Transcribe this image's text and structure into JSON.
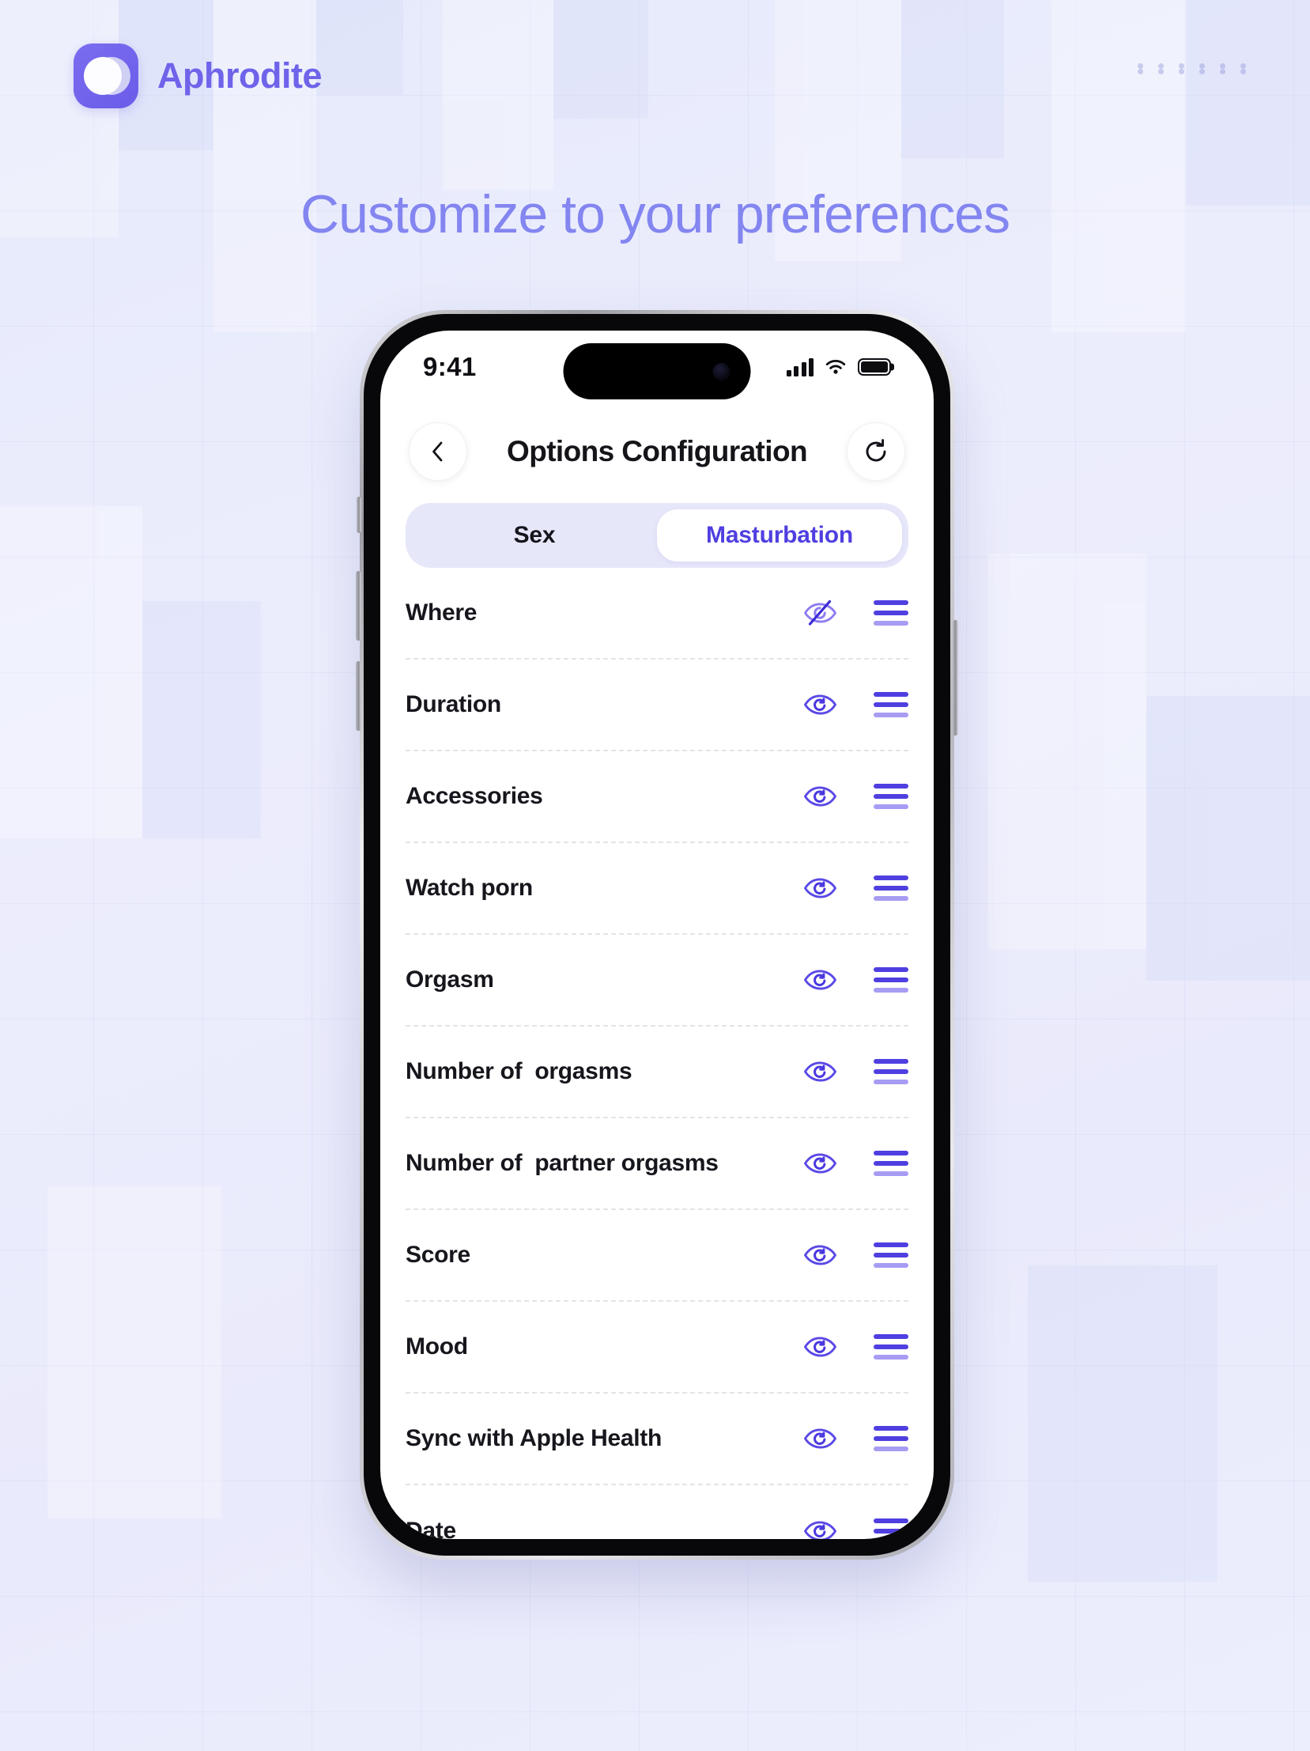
{
  "brand": {
    "name": "Aphrodite",
    "logo_icon": "moon-logo-icon",
    "accent_color": "#6f63ea"
  },
  "hero": {
    "heading": "Customize to your preferences",
    "color": "#8385f0"
  },
  "decoration": {
    "dot_grid_icon": "dot-grid-icon",
    "dot_count": 12
  },
  "phone": {
    "status_bar": {
      "time": "9:41",
      "cellular_icon": "signal-bars-icon",
      "wifi_icon": "wifi-icon",
      "battery_icon": "battery-full-icon"
    },
    "nav": {
      "back_icon": "chevron-left-icon",
      "title": "Options Configuration",
      "refresh_icon": "refresh-icon"
    },
    "segmented_control": {
      "options": [
        {
          "label": "Sex",
          "active": false
        },
        {
          "label": "Masturbation",
          "active": true
        }
      ],
      "active_index": 1,
      "active_text_color": "#4f3fe0",
      "track_color": "#e7e7fa"
    },
    "list": {
      "visibility_on_icon": "eye-icon",
      "visibility_off_icon": "eye-off-icon",
      "drag_handle_icon": "drag-handle-icon",
      "rows": [
        {
          "label": "Where",
          "visible": false
        },
        {
          "label": "Duration",
          "visible": true
        },
        {
          "label": "Accessories",
          "visible": true
        },
        {
          "label": "Watch porn",
          "visible": true
        },
        {
          "label": "Orgasm",
          "visible": true
        },
        {
          "label": "Number of  orgasms",
          "visible": true
        },
        {
          "label": "Number of  partner orgasms",
          "visible": true
        },
        {
          "label": "Score",
          "visible": true
        },
        {
          "label": "Mood",
          "visible": true
        },
        {
          "label": "Sync with Apple Health",
          "visible": true
        },
        {
          "label": "Date",
          "visible": true
        }
      ]
    }
  },
  "colors": {
    "page_background": "#e9ecfb",
    "accent": "#4f3fe0",
    "accent_light": "#a79cf3",
    "text_primary": "#16161d"
  }
}
